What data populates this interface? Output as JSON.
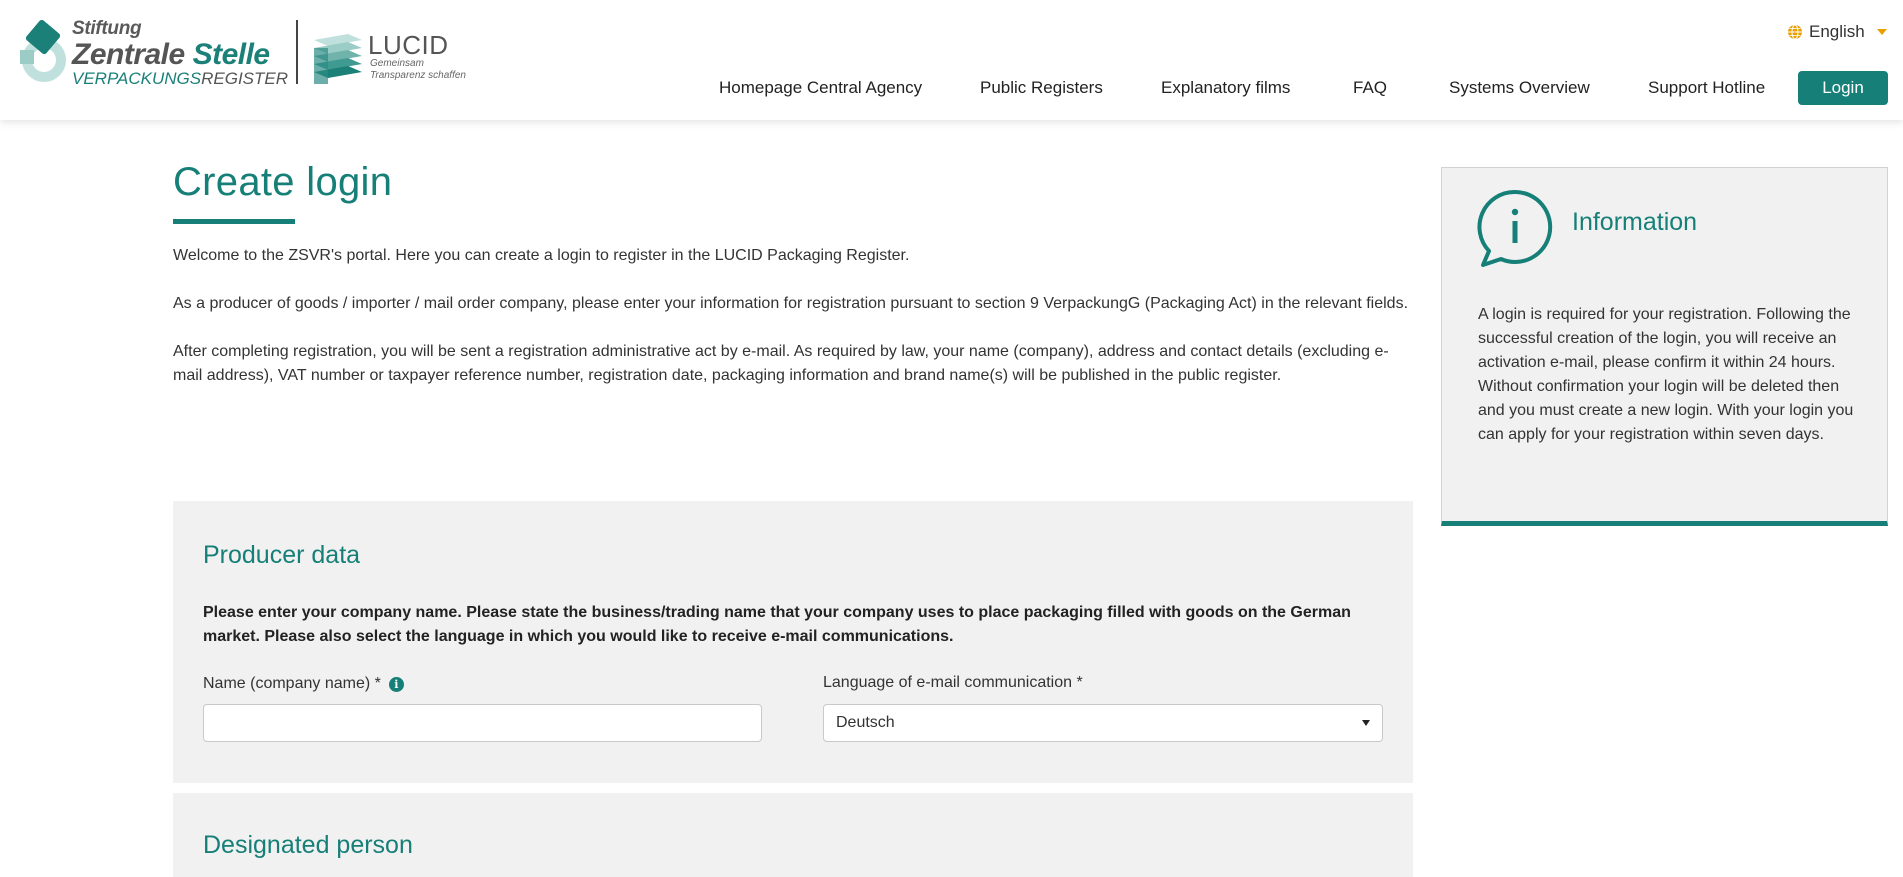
{
  "header": {
    "logo": {
      "line1": "Stiftung",
      "line2a": "Zentrale",
      "line2b": "Stelle",
      "line3a": "VERPACKUNGS",
      "line3b": "REGISTER",
      "lucid_title": "LUCID",
      "lucid_sub1": "Gemeinsam",
      "lucid_sub2": "Transparenz schaffen"
    },
    "language": {
      "label": "English",
      "icon": "globe-icon"
    },
    "nav": [
      "Homepage Central Agency",
      "Public Registers",
      "Explanatory films",
      "FAQ",
      "Systems Overview",
      "Support Hotline"
    ],
    "login_label": "Login"
  },
  "main": {
    "title": "Create login",
    "intro": [
      "Welcome to the ZSVR's portal. Here you can create a login to register in the LUCID Packaging Register.",
      "As a producer of goods / importer / mail order company, please enter your information for registration pursuant to section 9 VerpackungG (Packaging Act) in the relevant fields.",
      "After completing registration, you will be sent a registration administrative act by e-mail. As required by law, your name (company), address and contact details (excluding e-mail address), VAT number or taxpayer reference number, registration date, packaging information and brand name(s) will be published in the public register."
    ]
  },
  "producer": {
    "title": "Producer data",
    "note": "Please enter your company name. Please state the business/trading name that your company uses to place packaging filled with goods on the German market. Please also select the language in which you would like to receive e-mail communications.",
    "name_label": "Name (company name) *",
    "name_value": "",
    "language_label": "Language of e-mail communication *",
    "language_value": "Deutsch"
  },
  "designated": {
    "title": "Designated person"
  },
  "info": {
    "title": "Information",
    "text": "A login is required for your registration. Following the successful creation of the login, you will receive an activation e-mail, please confirm it within 24 hours. Without confirmation your login will be deleted then and you must create a new login. With your login you can apply for your registration within seven days."
  },
  "colors": {
    "accent": "#167f77",
    "panel": "#f1f1f1",
    "caret": "#e8a000"
  }
}
